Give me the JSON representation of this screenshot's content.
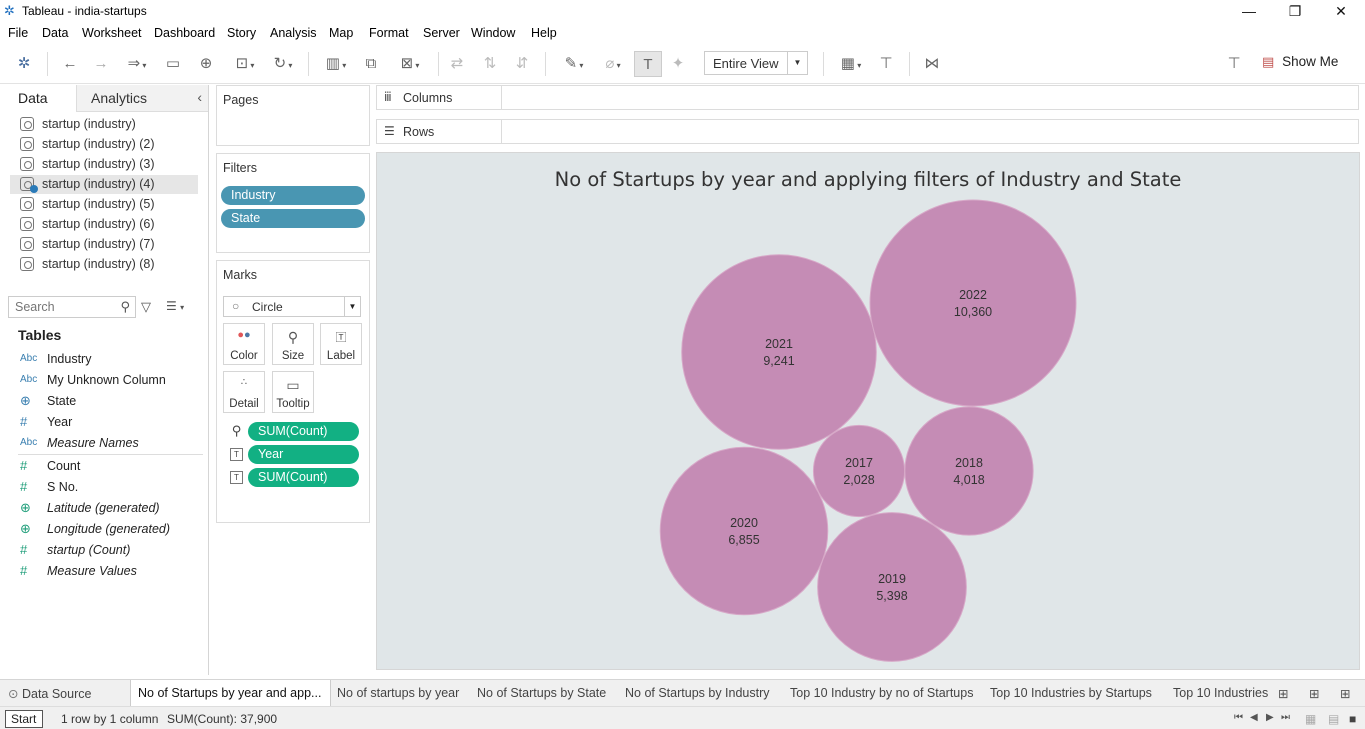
{
  "window": {
    "title": "Tableau - india-startups",
    "icon": "tableau-logo-icon",
    "controls": [
      "minimize-icon",
      "restore-icon",
      "close-icon"
    ]
  },
  "menu": [
    "File",
    "Data",
    "Worksheet",
    "Dashboard",
    "Story",
    "Analysis",
    "Map",
    "Format",
    "Server",
    "Window",
    "Help"
  ],
  "toolbar": {
    "fit_value": "Entire View",
    "show_me_label": "Show Me"
  },
  "data_pane": {
    "tab_data": "Data",
    "tab_analytics": "Analytics",
    "data_sources": [
      "startup (industry)",
      "startup (industry) (2)",
      "startup (industry) (3)",
      "startup (industry) (4)",
      "startup (industry) (5)",
      "startup (industry) (6)",
      "startup (industry) (7)",
      "startup (industry) (8)"
    ],
    "selected_source_index": 3,
    "search_placeholder": "Search",
    "tables_header": "Tables",
    "dimensions": [
      {
        "icon": "Abc",
        "label": "Industry",
        "kind": "string"
      },
      {
        "icon": "Abc",
        "label": "My Unknown Column",
        "kind": "string"
      },
      {
        "icon": "globe",
        "label": "State",
        "kind": "geo"
      },
      {
        "icon": "#",
        "label": "Year",
        "kind": "number"
      },
      {
        "icon": "Abc",
        "label": "Measure Names",
        "kind": "string",
        "italic": true
      }
    ],
    "measures": [
      {
        "icon": "#",
        "label": "Count",
        "kind": "measure"
      },
      {
        "icon": "#",
        "label": "S No.",
        "kind": "measure"
      },
      {
        "icon": "globe",
        "label": "Latitude (generated)",
        "kind": "geo",
        "italic": true
      },
      {
        "icon": "globe",
        "label": "Longitude (generated)",
        "kind": "geo",
        "italic": true
      },
      {
        "icon": "#",
        "label": "startup (Count)",
        "kind": "measure",
        "italic": true
      },
      {
        "icon": "#",
        "label": "Measure Values",
        "kind": "measure",
        "italic": true
      }
    ]
  },
  "cards": {
    "pages": "Pages",
    "filters_title": "Filters",
    "filters": [
      "Industry",
      "State"
    ],
    "marks_title": "Marks",
    "mark_type": "Circle",
    "mark_buttons": [
      "Color",
      "Size",
      "Label",
      "Detail",
      "Tooltip"
    ],
    "mark_pills": [
      {
        "icon": "size",
        "label": "SUM(Count)"
      },
      {
        "icon": "label",
        "label": "Year"
      },
      {
        "icon": "label",
        "label": "SUM(Count)"
      }
    ]
  },
  "shelves": {
    "columns": "Columns",
    "rows": "Rows"
  },
  "chart_data": {
    "type": "packed-bubble",
    "title": "No of Startups by year and applying filters of Industry and State",
    "color": "#c58cb5",
    "background": "#e0e6e8",
    "categories": [
      "2017",
      "2018",
      "2019",
      "2020",
      "2021",
      "2022"
    ],
    "values": [
      2028,
      4018,
      5398,
      6855,
      9241,
      10360
    ],
    "labels": [
      "2,028",
      "4,018",
      "5,398",
      "6,855",
      "9,241",
      "10,360"
    ]
  },
  "sheet_tabs": [
    "Data Source",
    "No of Startups by year and app...",
    "No of startups by year",
    "No of Startups by State",
    "No of Startups by Industry",
    "Top 10 Industry by no of Startups",
    "Top 10 Industries by Startups",
    "Top 10 Industries"
  ],
  "active_tab_index": 1,
  "status": {
    "start": "Start",
    "dims": "1 row by 1 column",
    "sum": "SUM(Count): 37,900"
  }
}
